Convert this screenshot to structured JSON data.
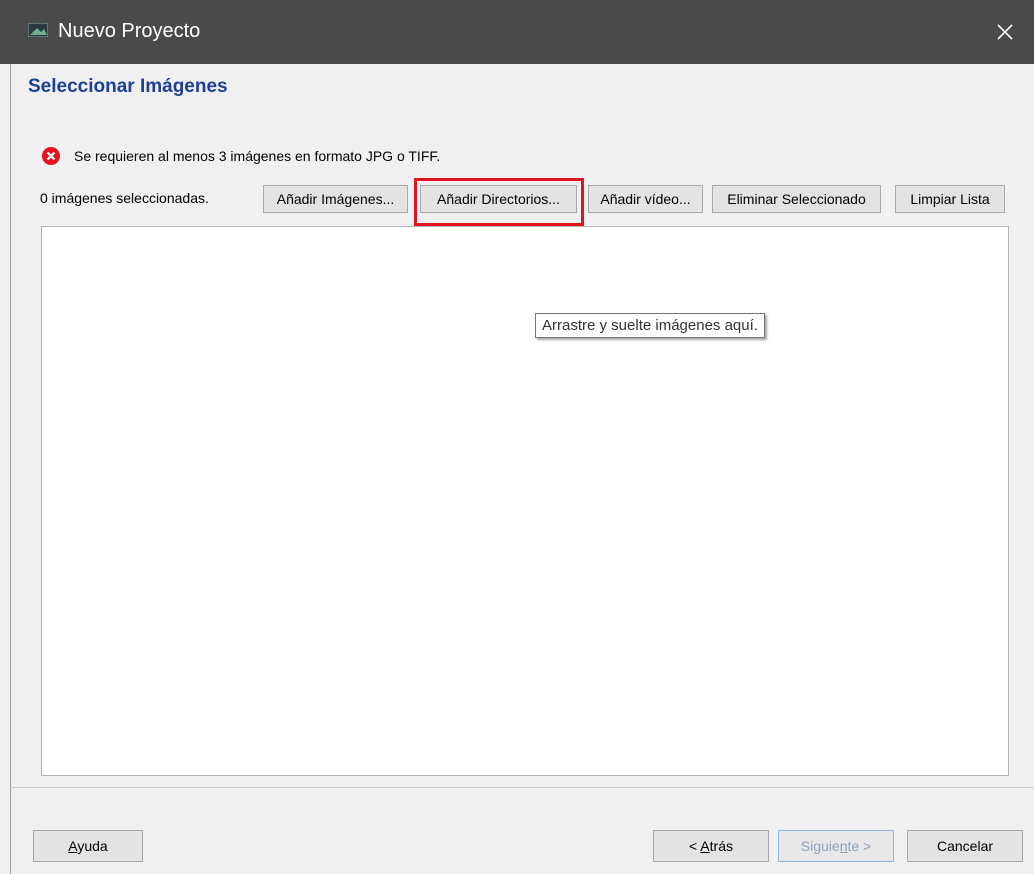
{
  "window": {
    "title": "Nuevo Proyecto",
    "close_icon": "close-icon",
    "app_icon": "app-icon"
  },
  "page": {
    "heading": "Seleccionar Imágenes",
    "heading_color": "#1c3f9a",
    "error_message": "Se requieren al menos 3 imágenes en formato JPG o TIFF.",
    "error_icon": "error-x-icon",
    "error_color": "#e3131f"
  },
  "toolbar": {
    "count_label": "0 imágenes seleccionadas.",
    "add_images": "Añadir Imágenes...",
    "add_directories": "Añadir Directorios...",
    "add_video": "Añadir vídeo...",
    "remove_selected": "Eliminar Seleccionado",
    "clear_list": "Limpiar Lista",
    "highlight_color": "#e3131f"
  },
  "dropzone": {
    "hint": "Arrastre y suelte imágenes aquí."
  },
  "footer": {
    "help": {
      "label": "Ayuda",
      "mnemonic": "A"
    },
    "back": {
      "label": "< Atrás",
      "mnemonic": "A"
    },
    "next": {
      "label": "Siguiente >",
      "mnemonic": "n",
      "enabled": false
    },
    "cancel": "Cancelar"
  }
}
